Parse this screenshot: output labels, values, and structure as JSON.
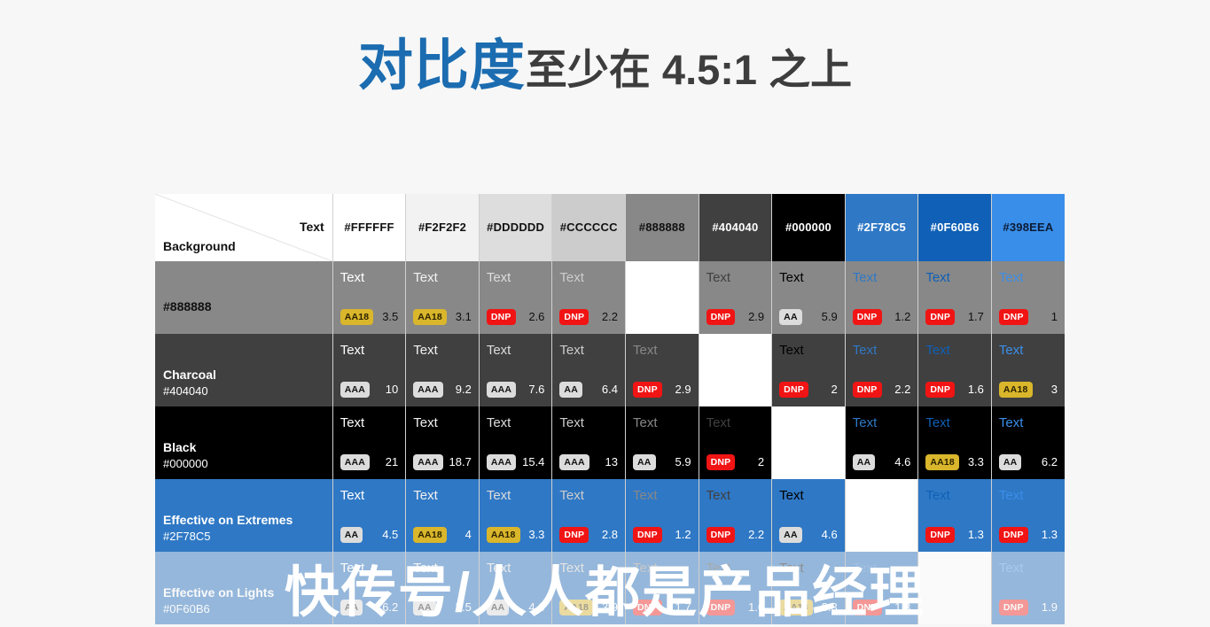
{
  "title": {
    "highlight": "对比度",
    "rest": "至少在 4.5:1 之上"
  },
  "watermark": "快传号/人人都是产品经理",
  "table": {
    "corner": {
      "text_label": "Text",
      "background_label": "Background"
    },
    "columns": [
      {
        "hex": "#FFFFFF",
        "bg": "#ffffff",
        "fg": "#111111"
      },
      {
        "hex": "#F2F2F2",
        "bg": "#f2f2f2",
        "fg": "#111111"
      },
      {
        "hex": "#DDDDDD",
        "bg": "#dddddd",
        "fg": "#111111"
      },
      {
        "hex": "#CCCCCC",
        "bg": "#cccccc",
        "fg": "#111111"
      },
      {
        "hex": "#888888",
        "bg": "#888888",
        "fg": "#111111"
      },
      {
        "hex": "#404040",
        "bg": "#404040",
        "fg": "#ffffff"
      },
      {
        "hex": "#000000",
        "bg": "#000000",
        "fg": "#ffffff"
      },
      {
        "hex": "#2F78C5",
        "bg": "#2f78c5",
        "fg": "#ffffff"
      },
      {
        "hex": "#0F60B6",
        "bg": "#0f60b6",
        "fg": "#ffffff"
      },
      {
        "hex": "#398EEA",
        "bg": "#398eea",
        "fg": "#0d1b33"
      }
    ],
    "sample_word": "Text",
    "rows": [
      {
        "name": "",
        "hex": "#888888",
        "bg": "#888888",
        "label_color": "#111111",
        "faded": false,
        "cells": [
          {
            "fg": "#ffffff",
            "badge": "AA18",
            "grade": "aa18",
            "ratio": "3.5",
            "ratio_color": "#111111"
          },
          {
            "fg": "#f2f2f2",
            "badge": "AA18",
            "grade": "aa18",
            "ratio": "3.1",
            "ratio_color": "#111111"
          },
          {
            "fg": "#dddddd",
            "badge": "DNP",
            "grade": "dnp",
            "ratio": "2.6",
            "ratio_color": "#111111"
          },
          {
            "fg": "#cccccc",
            "badge": "DNP",
            "grade": "dnp",
            "ratio": "2.2",
            "ratio_color": "#111111"
          },
          {
            "diagonal": true
          },
          {
            "fg": "#404040",
            "badge": "DNP",
            "grade": "dnp",
            "ratio": "2.9",
            "ratio_color": "#111111"
          },
          {
            "fg": "#000000",
            "badge": "AA",
            "grade": "aa",
            "ratio": "5.9",
            "ratio_color": "#111111"
          },
          {
            "fg": "#2f78c5",
            "badge": "DNP",
            "grade": "dnp",
            "ratio": "1.2",
            "ratio_color": "#111111"
          },
          {
            "fg": "#0f60b6",
            "badge": "DNP",
            "grade": "dnp",
            "ratio": "1.7",
            "ratio_color": "#111111"
          },
          {
            "fg": "#398eea",
            "badge": "DNP",
            "grade": "dnp",
            "ratio": "1",
            "ratio_color": "#111111"
          }
        ]
      },
      {
        "name": "Charcoal",
        "hex": "#404040",
        "bg": "#404040",
        "label_color": "#ffffff",
        "faded": false,
        "cells": [
          {
            "fg": "#ffffff",
            "badge": "AAA",
            "grade": "aaa",
            "ratio": "10",
            "ratio_color": "#ffffff"
          },
          {
            "fg": "#f2f2f2",
            "badge": "AAA",
            "grade": "aaa",
            "ratio": "9.2",
            "ratio_color": "#ffffff"
          },
          {
            "fg": "#dddddd",
            "badge": "AAA",
            "grade": "aaa",
            "ratio": "7.6",
            "ratio_color": "#ffffff"
          },
          {
            "fg": "#cccccc",
            "badge": "AA",
            "grade": "aa",
            "ratio": "6.4",
            "ratio_color": "#ffffff"
          },
          {
            "fg": "#888888",
            "badge": "DNP",
            "grade": "dnp",
            "ratio": "2.9",
            "ratio_color": "#ffffff"
          },
          {
            "diagonal": true
          },
          {
            "fg": "#000000",
            "badge": "DNP",
            "grade": "dnp",
            "ratio": "2",
            "ratio_color": "#ffffff"
          },
          {
            "fg": "#2f78c5",
            "badge": "DNP",
            "grade": "dnp",
            "ratio": "2.2",
            "ratio_color": "#ffffff"
          },
          {
            "fg": "#0f60b6",
            "badge": "DNP",
            "grade": "dnp",
            "ratio": "1.6",
            "ratio_color": "#ffffff"
          },
          {
            "fg": "#398eea",
            "badge": "AA18",
            "grade": "aa18",
            "ratio": "3",
            "ratio_color": "#ffffff"
          }
        ]
      },
      {
        "name": "Black",
        "hex": "#000000",
        "bg": "#000000",
        "label_color": "#ffffff",
        "faded": false,
        "cells": [
          {
            "fg": "#ffffff",
            "badge": "AAA",
            "grade": "aaa",
            "ratio": "21",
            "ratio_color": "#ffffff"
          },
          {
            "fg": "#f2f2f2",
            "badge": "AAA",
            "grade": "aaa",
            "ratio": "18.7",
            "ratio_color": "#ffffff"
          },
          {
            "fg": "#dddddd",
            "badge": "AAA",
            "grade": "aaa",
            "ratio": "15.4",
            "ratio_color": "#ffffff"
          },
          {
            "fg": "#cccccc",
            "badge": "AAA",
            "grade": "aaa",
            "ratio": "13",
            "ratio_color": "#ffffff"
          },
          {
            "fg": "#888888",
            "badge": "AA",
            "grade": "aa",
            "ratio": "5.9",
            "ratio_color": "#ffffff"
          },
          {
            "fg": "#404040",
            "badge": "DNP",
            "grade": "dnp",
            "ratio": "2",
            "ratio_color": "#ffffff"
          },
          {
            "diagonal": true
          },
          {
            "fg": "#2f78c5",
            "badge": "AA",
            "grade": "aa",
            "ratio": "4.6",
            "ratio_color": "#ffffff"
          },
          {
            "fg": "#0f60b6",
            "badge": "AA18",
            "grade": "aa18",
            "ratio": "3.3",
            "ratio_color": "#ffffff"
          },
          {
            "fg": "#398eea",
            "badge": "AA",
            "grade": "aa",
            "ratio": "6.2",
            "ratio_color": "#ffffff"
          }
        ]
      },
      {
        "name": "Effective on Extremes",
        "hex": "#2F78C5",
        "bg": "#2f78c5",
        "label_color": "#ffffff",
        "faded": false,
        "cells": [
          {
            "fg": "#ffffff",
            "badge": "AA",
            "grade": "aa",
            "ratio": "4.5",
            "ratio_color": "#ffffff"
          },
          {
            "fg": "#f2f2f2",
            "badge": "AA18",
            "grade": "aa18",
            "ratio": "4",
            "ratio_color": "#ffffff"
          },
          {
            "fg": "#dddddd",
            "badge": "AA18",
            "grade": "aa18",
            "ratio": "3.3",
            "ratio_color": "#ffffff"
          },
          {
            "fg": "#cccccc",
            "badge": "DNP",
            "grade": "dnp",
            "ratio": "2.8",
            "ratio_color": "#ffffff"
          },
          {
            "fg": "#888888",
            "badge": "DNP",
            "grade": "dnp",
            "ratio": "1.2",
            "ratio_color": "#ffffff"
          },
          {
            "fg": "#404040",
            "badge": "DNP",
            "grade": "dnp",
            "ratio": "2.2",
            "ratio_color": "#ffffff"
          },
          {
            "fg": "#000000",
            "badge": "AA",
            "grade": "aa",
            "ratio": "4.6",
            "ratio_color": "#ffffff"
          },
          {
            "diagonal": true
          },
          {
            "fg": "#0f60b6",
            "badge": "DNP",
            "grade": "dnp",
            "ratio": "1.3",
            "ratio_color": "#ffffff"
          },
          {
            "fg": "#398eea",
            "badge": "DNP",
            "grade": "dnp",
            "ratio": "1.3",
            "ratio_color": "#ffffff"
          }
        ]
      },
      {
        "name": "Effective on Lights",
        "hex": "#0F60B6",
        "bg": "#0f60b6",
        "label_color": "#ffffff",
        "faded": true,
        "cells": [
          {
            "fg": "#ffffff",
            "badge": "AA",
            "grade": "aa",
            "ratio": "6.2",
            "ratio_color": "#ffffff"
          },
          {
            "fg": "#f2f2f2",
            "badge": "AA",
            "grade": "aa",
            "ratio": "5.5",
            "ratio_color": "#ffffff"
          },
          {
            "fg": "#dddddd",
            "badge": "AA",
            "grade": "aa",
            "ratio": "4.6",
            "ratio_color": "#ffffff"
          },
          {
            "fg": "#cccccc",
            "badge": "AA18",
            "grade": "aa18",
            "ratio": "3.9",
            "ratio_color": "#ffffff"
          },
          {
            "fg": "#888888",
            "badge": "DNP",
            "grade": "dnp",
            "ratio": "1.7",
            "ratio_color": "#ffffff"
          },
          {
            "fg": "#404040",
            "badge": "DNP",
            "grade": "dnp",
            "ratio": "1.6",
            "ratio_color": "#ffffff"
          },
          {
            "fg": "#000000",
            "badge": "AA18",
            "grade": "aa18",
            "ratio": "3.3",
            "ratio_color": "#ffffff"
          },
          {
            "fg": "#2f78c5",
            "badge": "DNP",
            "grade": "dnp",
            "ratio": "1.3",
            "ratio_color": "#ffffff"
          },
          {
            "diagonal": true
          },
          {
            "fg": "#398eea",
            "badge": "DNP",
            "grade": "dnp",
            "ratio": "1.9",
            "ratio_color": "#ffffff"
          }
        ]
      }
    ]
  }
}
